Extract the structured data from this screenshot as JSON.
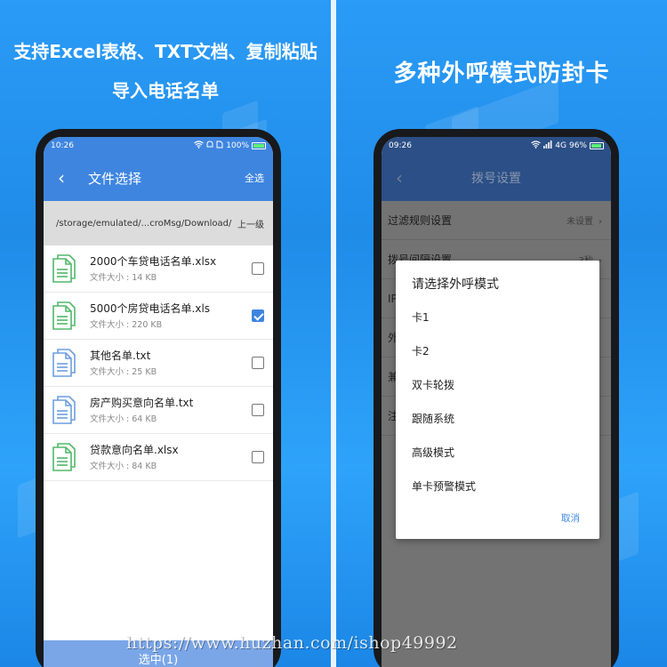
{
  "left": {
    "headline_line1": "支持Excel表格、TXT文档、复制粘贴",
    "headline_line2": "导入电话名单",
    "status": {
      "time": "10:26",
      "battery": "100%"
    },
    "appbar": {
      "back_icon": "‹",
      "title": "文件选择",
      "action": "全选"
    },
    "path": {
      "text": "/storage/emulated/...croMsg/Download/",
      "up": "上一级"
    },
    "files": [
      {
        "name": "2000个车贷电话名单.xlsx",
        "size": "文件大小 : 14 KB",
        "type": "excel",
        "checked": false
      },
      {
        "name": "5000个房贷电话名单.xls",
        "size": "文件大小 : 220 KB",
        "type": "excel",
        "checked": true
      },
      {
        "name": "其他名单.txt",
        "size": "文件大小 : 25 KB",
        "type": "txt",
        "checked": false
      },
      {
        "name": "房产购买意向名单.txt",
        "size": "文件大小 : 64 KB",
        "type": "txt",
        "checked": false
      },
      {
        "name": "贷款意向名单.xlsx",
        "size": "文件大小 : 84 KB",
        "type": "excel",
        "checked": false
      }
    ],
    "bottom_button": "选中(1)"
  },
  "right": {
    "headline": "多种外呼模式防封卡",
    "status": {
      "time": "09:26",
      "network": "4G",
      "battery": "96%"
    },
    "appbar": {
      "back_icon": "‹",
      "title": "拨号设置"
    },
    "rows": [
      {
        "label": "过滤规则设置",
        "value": "未设置"
      },
      {
        "label": "拨号间隔设置",
        "value": "3秒"
      },
      {
        "label": "IP",
        "value": ""
      },
      {
        "label": "外",
        "value": ""
      },
      {
        "label": "兼",
        "value": ""
      },
      {
        "label": "注",
        "value": ""
      }
    ],
    "dialog": {
      "title": "请选择外呼模式",
      "options": [
        "卡1",
        "卡2",
        "双卡轮拨",
        "跟随系统",
        "高级模式",
        "单卡预警模式"
      ],
      "cancel": "取消"
    }
  },
  "watermark": "https://www.huzhan.com/ishop49992",
  "colors": {
    "accent": "#3e85e0",
    "excel_icon": "#52b86a",
    "txt_icon": "#6d9ee0",
    "panel_bg": "#2a9bf6"
  }
}
